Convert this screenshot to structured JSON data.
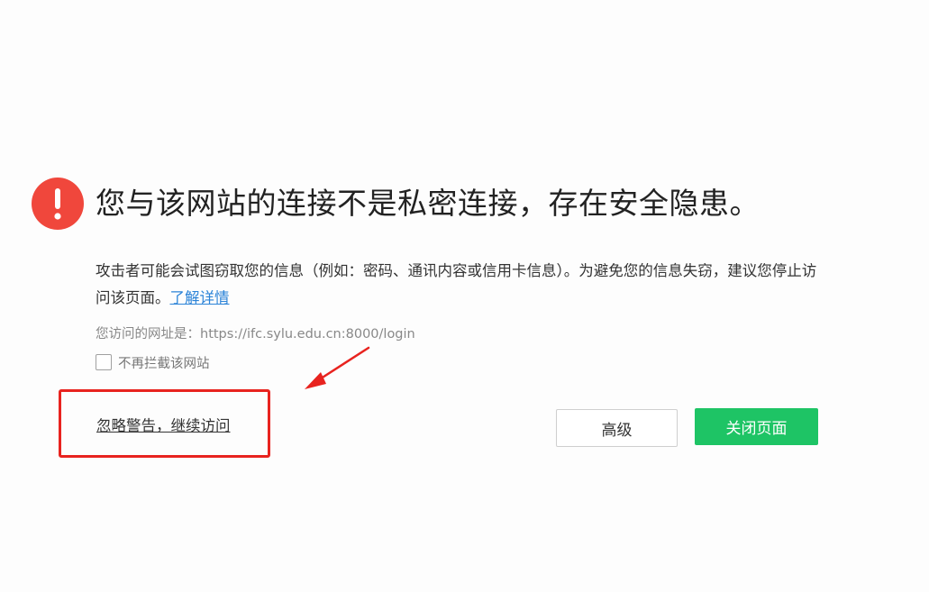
{
  "warning": {
    "icon": "exclamation-circle-icon",
    "icon_color": "#f0473c",
    "headline": "您与该网站的连接不是私密连接，存在安全隐患。",
    "description": "攻击者可能会试图窃取您的信息（例如：密码、通讯内容或信用卡信息）。为避免您的信息失窃，建议您停止访问该页面。",
    "learn_more_label": "了解详情",
    "url_line": "您访问的网址是：https://ifc.sylu.edu.cn:8000/login",
    "dont_block_label": "不再拦截该网站",
    "dont_block_checked": false
  },
  "actions": {
    "ignore_label": "忽略警告，继续访问",
    "advanced_label": "高级",
    "close_label": "关闭页面",
    "close_color": "#1ec465"
  },
  "annotations": {
    "highlight_color": "#e8231f",
    "arrow_color": "#e8231f"
  }
}
